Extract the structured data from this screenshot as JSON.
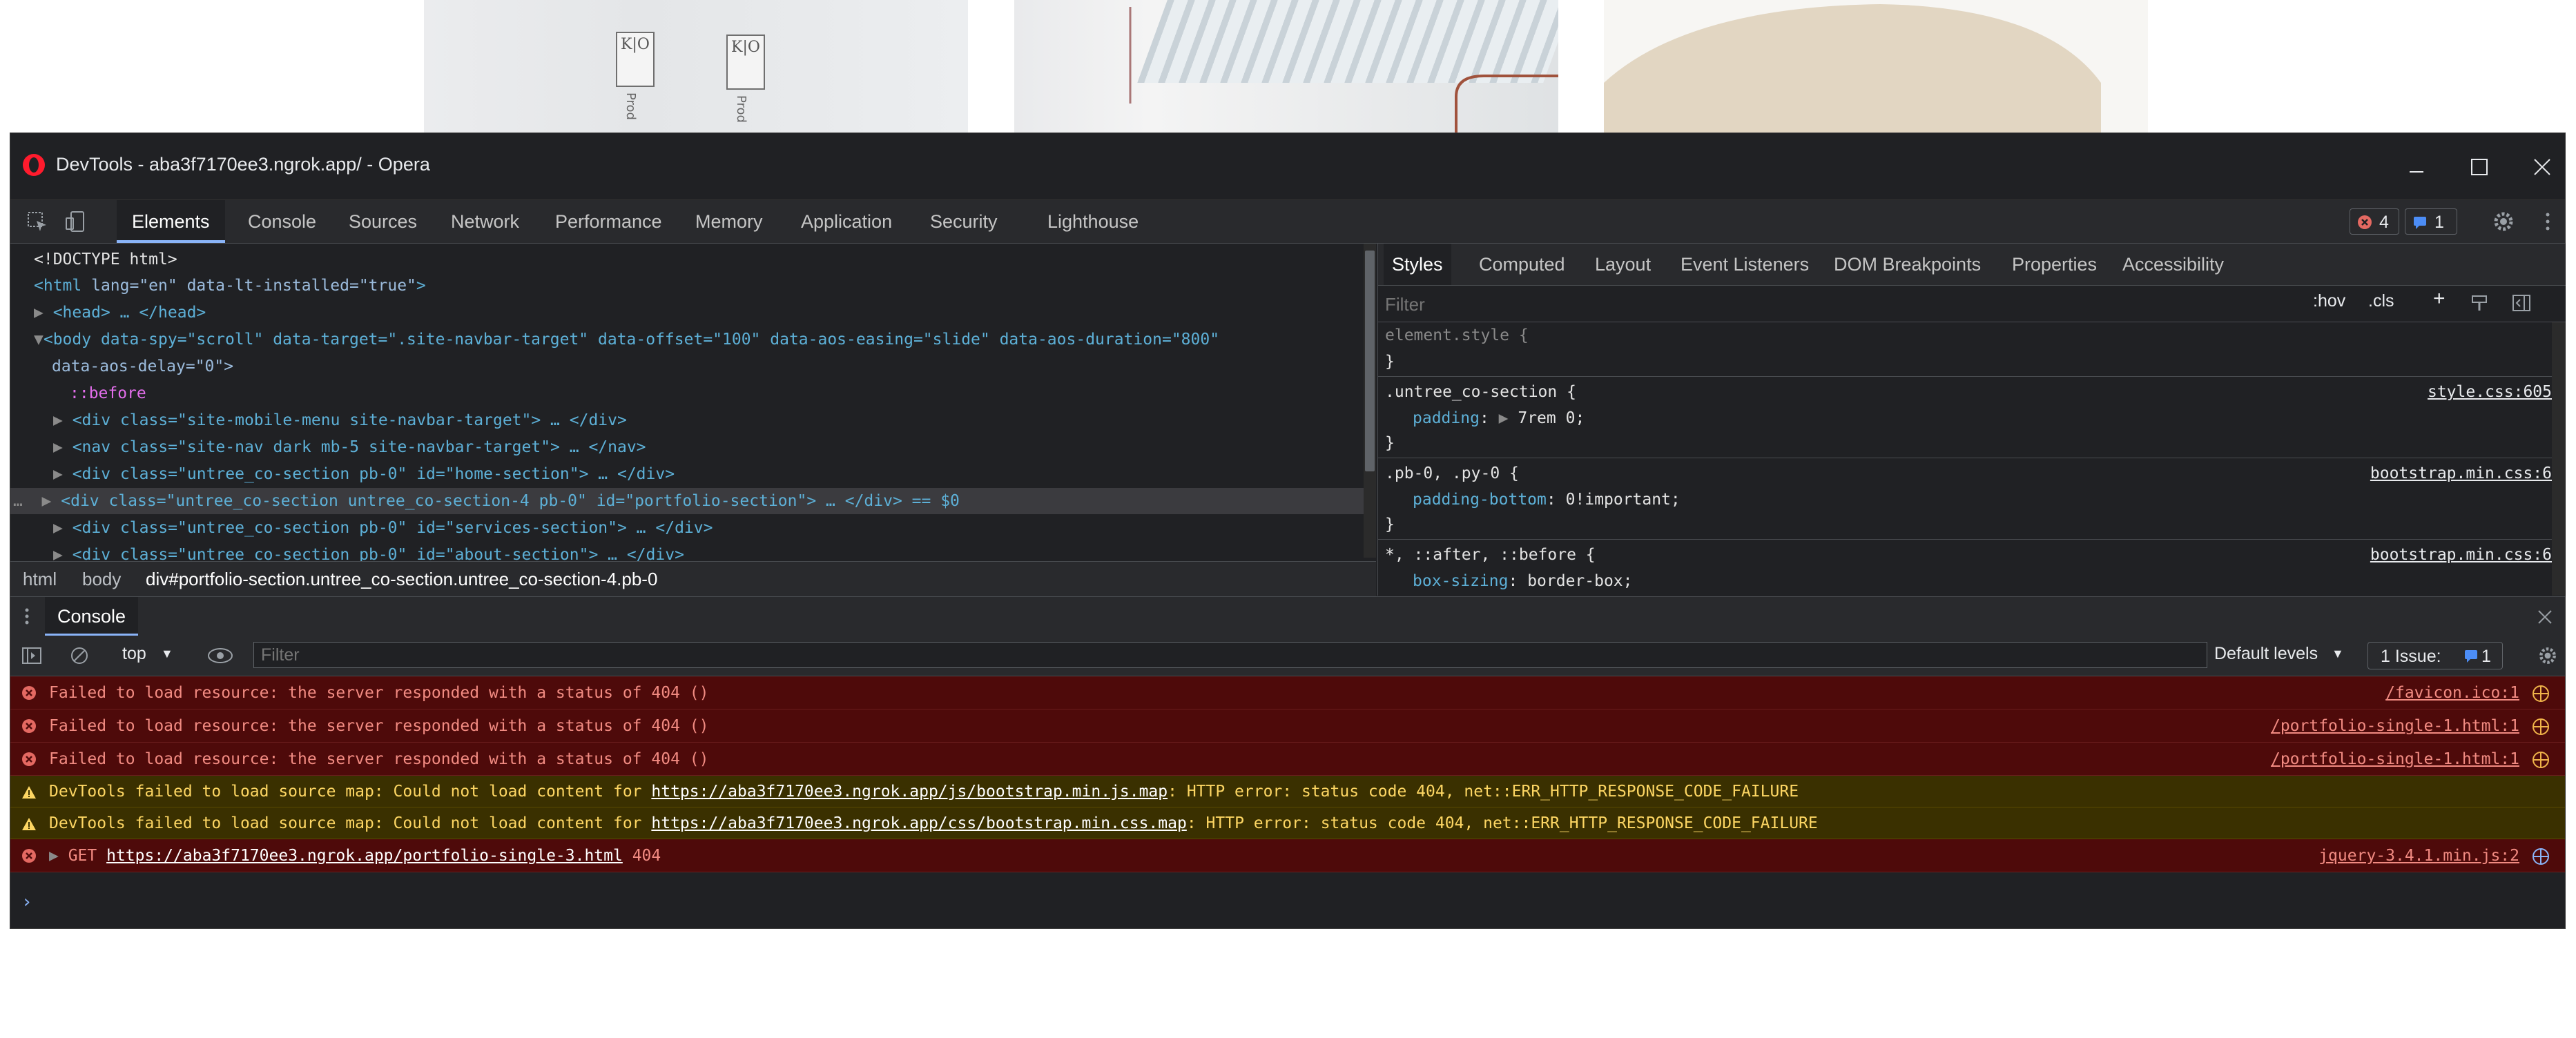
{
  "window": {
    "title": "DevTools - aba3f7170ee3.ngrok.app/ - Opera"
  },
  "site": {
    "box_letters": "K|O",
    "box_caption": "Prod"
  },
  "main_tabs": [
    "Elements",
    "Console",
    "Sources",
    "Network",
    "Performance",
    "Memory",
    "Application",
    "Security",
    "Lighthouse"
  ],
  "badges": {
    "errors": "4",
    "issues": "1"
  },
  "elements": {
    "lines": [
      {
        "text": "<!DOCTYPE html>"
      },
      {
        "tag_open": "<html ",
        "attrs": "lang=\"en\" data-lt-installed=\"true\"",
        "tag_close": ">"
      },
      {
        "text": "<head> … </head>"
      },
      {
        "text": "<body data-spy=\"scroll\" data-target=\".site-navbar-target\" data-offset=\"100\" data-aos-easing=\"slide\" data-aos-duration=\"800\""
      },
      {
        "text": "data-aos-delay=\"0\">"
      },
      {
        "text": "::before"
      },
      {
        "text": "<div class=\"site-mobile-menu site-navbar-target\"> … </div>"
      },
      {
        "text": "<nav class=\"site-nav dark mb-5 site-navbar-target\"> … </nav>"
      },
      {
        "text": "<div class=\"untree_co-section pb-0\" id=\"home-section\"> … </div>"
      },
      {
        "text": "<div class=\"untree_co-section untree_co-section-4 pb-0\" id=\"portfolio-section\"> … </div> == $0"
      },
      {
        "text": "<div class=\"untree_co-section pb-0\" id=\"services-section\"> … </div>"
      },
      {
        "text": "<div class=\"untree_co-section pb-0\" id=\"about-section\"> … </div>"
      }
    ]
  },
  "breadcrumb": [
    "html",
    "body",
    "div#portfolio-section.untree_co-section.untree_co-section-4.pb-0"
  ],
  "styles": {
    "tabs": [
      "Styles",
      "Computed",
      "Layout",
      "Event Listeners",
      "DOM Breakpoints",
      "Properties",
      "Accessibility"
    ],
    "filter_placeholder": "Filter",
    "hov": ":hov",
    "cls": ".cls",
    "rules": [
      {
        "selector": "element.style {",
        "props": [],
        "close": "}",
        "source": ""
      },
      {
        "selector": ".untree_co-section {",
        "props": [
          {
            "name": "padding",
            "value": "7rem 0;"
          }
        ],
        "close": "}",
        "source": "style.css:605"
      },
      {
        "selector": ".pb-0, .py-0 {",
        "props": [
          {
            "name": "padding-bottom",
            "value": "0!important;"
          }
        ],
        "close": "}",
        "source": "bootstrap.min.css:6"
      },
      {
        "selector": "*, ::after, ::before {",
        "props": [
          {
            "name": "box-sizing",
            "value": "border-box;"
          }
        ],
        "close": "",
        "source": "bootstrap.min.css:6"
      }
    ]
  },
  "console": {
    "drawer_tab": "Console",
    "context": "top",
    "filter_placeholder": "Filter",
    "levels": "Default levels",
    "issues_label": "1 Issue:",
    "issues_count": "1",
    "messages": [
      {
        "level": "error",
        "text": "Failed to load resource: the server responded with a status of 404 ()",
        "source": "/favicon.ico:1"
      },
      {
        "level": "error",
        "text": "Failed to load resource: the server responded with a status of 404 ()",
        "source": "/portfolio-single-1.html:1"
      },
      {
        "level": "error",
        "text": "Failed to load resource: the server responded with a status of 404 ()",
        "source": "/portfolio-single-1.html:1"
      },
      {
        "level": "warning",
        "prefix": "DevTools failed to load source map: Could not load content for ",
        "link": "https://aba3f7170ee3.ngrok.app/js/bootstrap.min.js.map",
        "suffix": ": HTTP error: status code 404, net::ERR_HTTP_RESPONSE_CODE_FAILURE"
      },
      {
        "level": "warning",
        "prefix": "DevTools failed to load source map: Could not load content for ",
        "link": "https://aba3f7170ee3.ngrok.app/css/bootstrap.min.css.map",
        "suffix": ": HTTP error: status code 404, net::ERR_HTTP_RESPONSE_CODE_FAILURE"
      },
      {
        "level": "error",
        "prefix": "GET ",
        "link": "https://aba3f7170ee3.ngrok.app/portfolio-single-3.html",
        "suffix": " 404",
        "source": "jquery-3.4.1.min.js:2"
      }
    ],
    "prompt": "›"
  },
  "colors": {
    "error_bg": "#4e0a0a",
    "warning_bg": "#3a3000",
    "accent": "#8ab4f8",
    "devtools_bg": "#202124"
  },
  "icons": [
    "opera-logo-icon",
    "inspect-icon",
    "device-toolbar-icon",
    "error-icon",
    "message-icon",
    "gear-icon",
    "more-icon",
    "sidebar-icon",
    "clear-icon",
    "eye-icon",
    "warning-icon",
    "network-globe-icon",
    "close-icon",
    "kebab-icon"
  ]
}
